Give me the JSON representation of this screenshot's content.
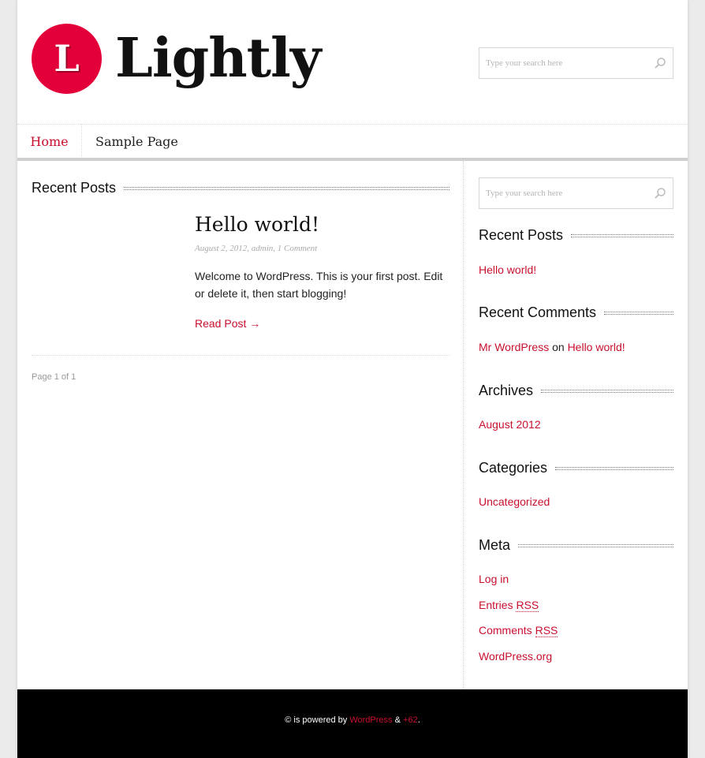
{
  "header": {
    "logo_letter": "L",
    "site_name": "Lightly",
    "search_placeholder": "Type your search here"
  },
  "nav": {
    "items": [
      {
        "label": "Home"
      },
      {
        "label": "Sample Page"
      }
    ]
  },
  "main": {
    "section_title": "Recent Posts",
    "post": {
      "title": "Hello world!",
      "meta": "August 2, 2012, admin, 1 Comment",
      "excerpt": "Welcome to WordPress. This is your first post. Edit or delete it, then start blogging!",
      "read_more": "Read Post →"
    },
    "pagination": "Page 1 of 1"
  },
  "sidebar": {
    "search_placeholder": "Type your search here",
    "recent_posts": {
      "title": "Recent Posts",
      "items": [
        "Hello world!"
      ]
    },
    "recent_comments": {
      "title": "Recent Comments",
      "author": "Mr WordPress",
      "on": "on",
      "post": "Hello world!"
    },
    "archives": {
      "title": "Archives",
      "items": [
        "August 2012"
      ]
    },
    "categories": {
      "title": "Categories",
      "items": [
        "Uncategorized"
      ]
    },
    "meta": {
      "title": "Meta",
      "login": "Log in",
      "entries": "Entries",
      "comments": "Comments",
      "rss": "RSS",
      "wordpress_org": "WordPress.org"
    }
  },
  "footer": {
    "prefix": "© is powered by",
    "wordpress": "WordPress",
    "amp": "&",
    "plus": "+62",
    "end": "."
  },
  "colors": {
    "accent": "#c8102e",
    "logo_red": "#e3003a",
    "footer_bg": "#000000"
  }
}
